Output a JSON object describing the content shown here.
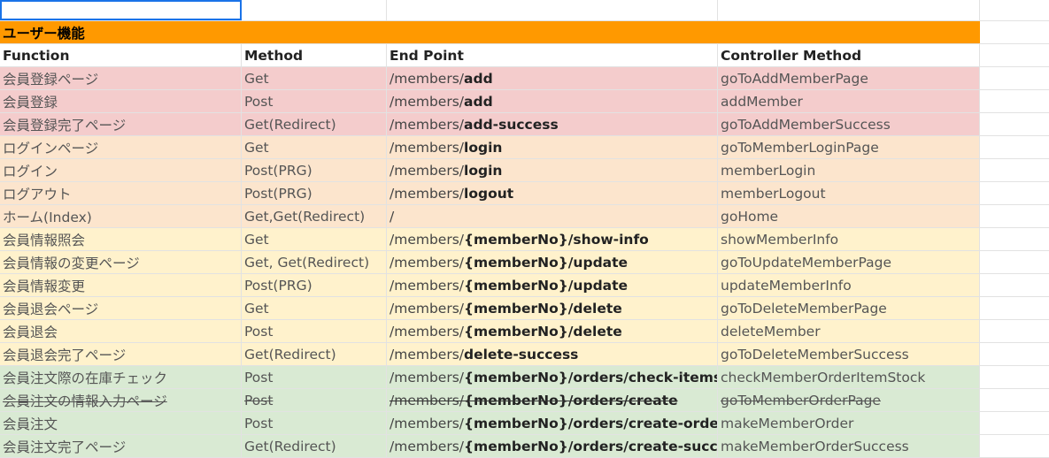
{
  "section_title": "ユーザー機能",
  "headers": {
    "function": "Function",
    "method": "Method",
    "endpoint": "End Point",
    "controller": "Controller Method"
  },
  "rows": [
    {
      "function": "会員登録ページ",
      "method": "Get",
      "ep_prefix": "/members/",
      "ep_bold": "add",
      "controller": "goToAddMemberPage"
    },
    {
      "function": "会員登録",
      "method": "Post",
      "ep_prefix": "/members/",
      "ep_bold": "add",
      "controller": "addMember"
    },
    {
      "function": "会員登録完了ページ",
      "method": "Get(Redirect)",
      "ep_prefix": "/members/",
      "ep_bold": "add-success",
      "controller": "goToAddMemberSuccess"
    },
    {
      "function": "ログインページ",
      "method": "Get",
      "ep_prefix": "/members/",
      "ep_bold": "login",
      "controller": "goToMemberLoginPage"
    },
    {
      "function": "ログイン",
      "method": "Post(PRG)",
      "ep_prefix": "/members/",
      "ep_bold": "login",
      "controller": "memberLogin"
    },
    {
      "function": "ログアウト",
      "method": "Post(PRG)",
      "ep_prefix": "/members/",
      "ep_bold": "logout",
      "controller": "memberLogout"
    },
    {
      "function": "ホーム(Index)",
      "method": "Get,Get(Redirect)",
      "ep_prefix": "/",
      "ep_bold": "",
      "controller": "goHome"
    },
    {
      "function": "会員情報照会",
      "method": "Get",
      "ep_prefix": "/members/",
      "ep_bold": "{memberNo}/show-info",
      "controller": "showMemberInfo"
    },
    {
      "function": "会員情報の変更ページ",
      "method": "Get, Get(Redirect)",
      "ep_prefix": "/members/",
      "ep_bold": "{memberNo}/update",
      "controller": "goToUpdateMemberPage"
    },
    {
      "function": "会員情報変更",
      "method": "Post(PRG)",
      "ep_prefix": "/members/",
      "ep_bold": "{memberNo}/update",
      "controller": "updateMemberInfo"
    },
    {
      "function": "会員退会ページ",
      "method": "Get",
      "ep_prefix": "/members/",
      "ep_bold": "{memberNo}/delete",
      "controller": "goToDeleteMemberPage"
    },
    {
      "function": "会員退会",
      "method": "Post",
      "ep_prefix": "/members/",
      "ep_bold": "{memberNo}/delete",
      "controller": "deleteMember"
    },
    {
      "function": "会員退会完了ページ",
      "method": "Get(Redirect)",
      "ep_prefix": "/members/",
      "ep_bold": "delete-success",
      "controller": "goToDeleteMemberSuccess"
    },
    {
      "function": "会員注文際の在庫チェック",
      "method": "Post",
      "ep_prefix": "/members/",
      "ep_bold": "{memberNo}/orders/check-itemstock",
      "controller": "checkMemberOrderItemStock"
    },
    {
      "function": "会員注文の情報入力ページ",
      "method": "Post",
      "ep_prefix": "/members/",
      "ep_bold": "{memberNo}/orders/create",
      "controller": "goToMemberOrderPage"
    },
    {
      "function": "会員注文",
      "method": "Post",
      "ep_prefix": "/members/",
      "ep_bold": "{memberNo}/orders/create-order",
      "controller": "makeMemberOrder"
    },
    {
      "function": "会員注文完了ページ",
      "method": "Get(Redirect)",
      "ep_prefix": "/members/",
      "ep_bold": "{memberNo}/orders/create-success",
      "controller": "makeMemberOrderSuccess"
    }
  ],
  "colors": {
    "section": "#ff9900",
    "pink": "#f4cccc",
    "peach": "#fce5cd",
    "yellow": "#fff2cc",
    "green": "#d9ead3",
    "selection": "#1a73e8"
  }
}
